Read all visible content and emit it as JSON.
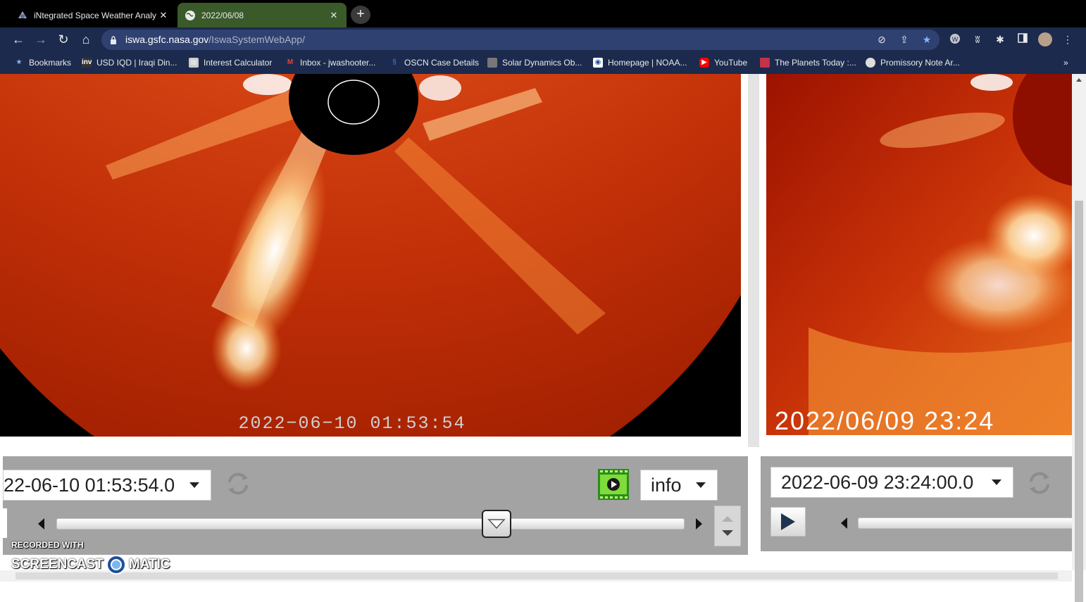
{
  "browser": {
    "tabs": [
      {
        "title": "iNtegrated Space Weather Analy",
        "active": false
      },
      {
        "title": "2022/06/08",
        "active": true
      }
    ],
    "url_host": "iswa.gsfc.nasa.gov",
    "url_path": "/IswaSystemWebApp/",
    "bookmarks": [
      {
        "label": "Bookmarks",
        "icon": "star-icon"
      },
      {
        "label": "USD IQD | Iraqi Din...",
        "icon": "inv-icon"
      },
      {
        "label": "Interest Calculator",
        "icon": "calculator-icon"
      },
      {
        "label": "Inbox - jwashooter...",
        "icon": "gmail-icon"
      },
      {
        "label": "OSCN Case Details",
        "icon": "oscn-icon"
      },
      {
        "label": "Solar Dynamics Ob...",
        "icon": "sdo-icon"
      },
      {
        "label": "Homepage | NOAA...",
        "icon": "noaa-icon"
      },
      {
        "label": "YouTube",
        "icon": "youtube-icon"
      },
      {
        "label": "The Planets Today :...",
        "icon": "planets-icon"
      },
      {
        "label": "Promissory Note Ar...",
        "icon": "promissory-icon"
      }
    ],
    "more_bookmarks": "»"
  },
  "left_panel": {
    "image_timestamp": "2022−06−10  01:53:54",
    "date_value": "22-06-10 01:53:54.0",
    "info_label": "info",
    "slider_position": 0.7
  },
  "right_panel": {
    "image_timestamp": "2022/06/09  23:24",
    "date_value": "2022-06-09 23:24:00.0"
  },
  "watermark": {
    "line1": "RECORDED WITH",
    "line2_a": "SCREENCAST",
    "line2_b": "MATIC"
  },
  "colors": {
    "chrome_bg": "#1c2a4d",
    "active_tab": "#3a5a2a",
    "control_bg": "#a3a3a3"
  }
}
